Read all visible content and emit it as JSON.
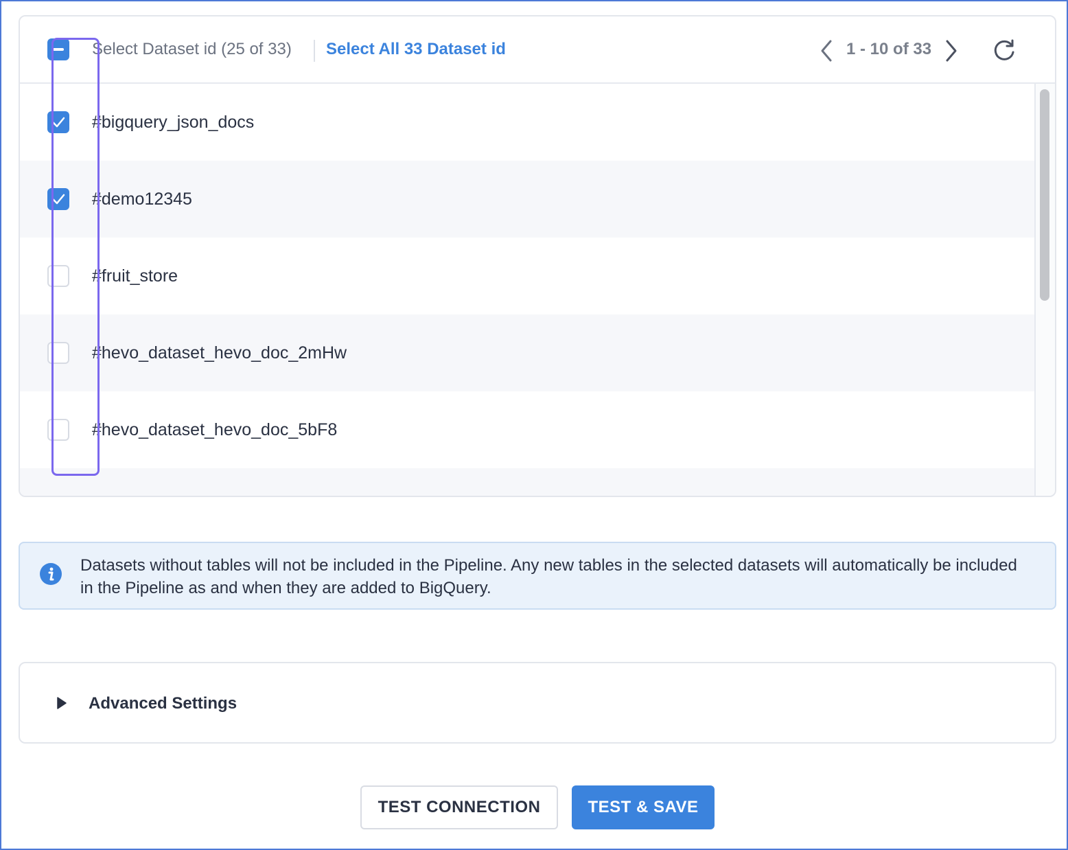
{
  "dataset_selector": {
    "header": {
      "label": "Select Dataset id (25 of 33)",
      "select_all_label": "Select All 33 Dataset id",
      "select_state": "partial",
      "pagination": "1 - 10 of 33",
      "prev_icon": "chevron-left-icon",
      "next_icon": "chevron-right-icon",
      "refresh_icon": "refresh-icon"
    },
    "rows": [
      {
        "name": "#bigquery_json_docs",
        "checked": true
      },
      {
        "name": "#demo12345",
        "checked": true
      },
      {
        "name": "#fruit_store",
        "checked": false
      },
      {
        "name": "#hevo_dataset_hevo_doc_2mHw",
        "checked": false
      },
      {
        "name": "#hevo_dataset_hevo_doc_5bF8",
        "checked": false
      }
    ]
  },
  "info_banner": {
    "icon": "info-icon",
    "text": "Datasets without tables will not be included in the Pipeline. Any new tables in the selected datasets will automatically be included in the Pipeline as and when they are added to BigQuery."
  },
  "advanced_settings": {
    "label": "Advanced Settings",
    "icon": "caret-right-icon",
    "expanded": false
  },
  "actions": {
    "test_connection_label": "TEST CONNECTION",
    "test_save_label": "TEST & SAVE"
  },
  "colors": {
    "accent": "#3b83dd",
    "highlight": "#7b68ee",
    "info_bg": "#eaf2fb"
  }
}
